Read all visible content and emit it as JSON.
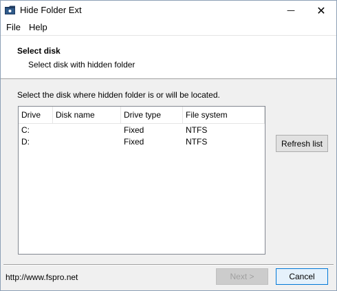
{
  "window": {
    "title": "Hide Folder Ext",
    "minimize_glyph": "—",
    "close_glyph": "✕"
  },
  "menu": {
    "items": [
      {
        "label": "File"
      },
      {
        "label": "Help"
      }
    ]
  },
  "header": {
    "title": "Select disk",
    "subtitle": "Select disk with hidden folder"
  },
  "main": {
    "instruction": "Select the disk where hidden folder is or will be located.",
    "columns": [
      "Drive",
      "Disk name",
      "Drive type",
      "File system"
    ],
    "rows": [
      {
        "drive": "C:",
        "disk_name": "",
        "drive_type": "Fixed",
        "file_system": "NTFS"
      },
      {
        "drive": "D:",
        "disk_name": "",
        "drive_type": "Fixed",
        "file_system": "NTFS"
      }
    ],
    "refresh_label": "Refresh list"
  },
  "footer": {
    "url": "http://www.fspro.net",
    "next_label": "Next >",
    "cancel_label": "Cancel"
  },
  "colors": {
    "accent": "#0078d7",
    "folder_icon": "#1e3a5f"
  },
  "icons": {
    "app": "folder-icon",
    "minimize": "minimize-icon",
    "close": "close-icon"
  }
}
